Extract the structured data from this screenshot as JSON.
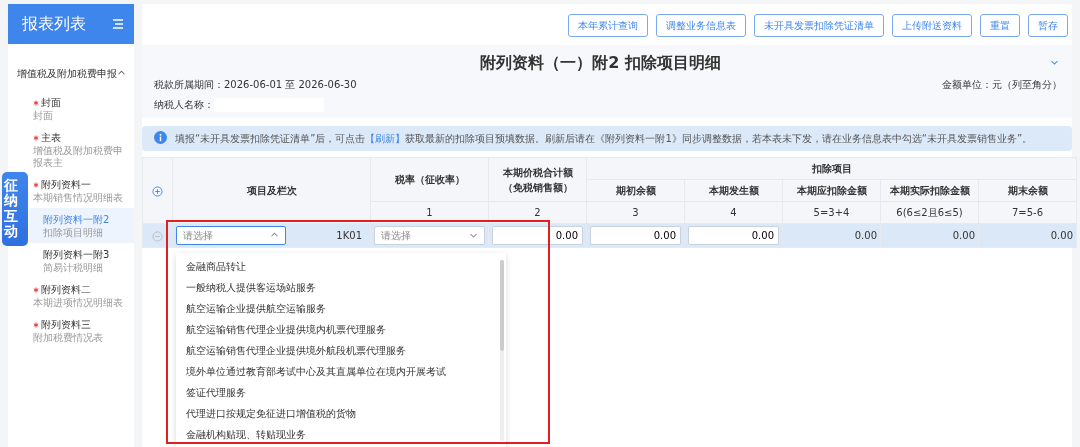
{
  "sidebar": {
    "title": "报表列表",
    "group": {
      "label": "增值税及附加税费申报",
      "expanded": true,
      "items": [
        {
          "title": "封面",
          "subtitle": "封面",
          "required": true,
          "selected": false
        },
        {
          "title": "主表",
          "subtitle": "增值税及附加税费申报表主",
          "required": true,
          "selected": false
        },
        {
          "title": "附列资料一",
          "subtitle": "本期销售情况明细表",
          "required": true,
          "selected": false,
          "children": [
            {
              "title": "附列资料一附2",
              "subtitle": "扣除项目明细",
              "required": false,
              "selected": true
            },
            {
              "title": "附列资料一附3",
              "subtitle": "简易计税明细",
              "required": false,
              "selected": false
            }
          ]
        },
        {
          "title": "附列资料二",
          "subtitle": "本期进项情况明细表",
          "required": true,
          "selected": false
        },
        {
          "title": "附列资料三",
          "subtitle": "附加税费情况表",
          "required": true,
          "selected": false
        }
      ]
    }
  },
  "float_tab": "征纳互动",
  "toolbar": {
    "buttons": [
      "本年累计查询",
      "调整业务信息表",
      "未开具发票扣除凭证清单",
      "上传附送资料",
      "重置",
      "暂存"
    ]
  },
  "header": {
    "title": "附列资料（一）附2 扣除项目明细",
    "period": "税款所属期间：2026-06-01 至 2026-06-30",
    "taxpayer_label": "纳税人名称：",
    "unit": "金额单位：元（列至角分）",
    "expanded": true
  },
  "notice": {
    "before": "填报“未开具发票扣除凭证清单”后，可点击",
    "link": "【刷新】",
    "after": "获取最新的扣除项目预填数据。刷新后请在《附列资料一附1》同步调整数据，若本表未下发，请在业务信息表中勾选“未开具发票销售业务”。"
  },
  "table": {
    "columns": [
      {
        "label": "项目及栏次"
      },
      {
        "label": "税率（征收率）",
        "number": "1"
      },
      {
        "label": "本期价税合计额（免税销售额）",
        "number": "2"
      }
    ],
    "group": {
      "label": "扣除项目",
      "columns": [
        {
          "label": "期初余额",
          "number": "3"
        },
        {
          "label": "本期发生额",
          "number": "4"
        },
        {
          "label": "本期应扣除金额",
          "number": "5=3+4"
        },
        {
          "label": "本期实际扣除金额",
          "number": "6(6≤2且6≤5)"
        },
        {
          "label": "期末余额",
          "number": "7=5-6"
        }
      ]
    },
    "rows": [
      {
        "selected": true,
        "cells": [
          {
            "kind": "select",
            "placeholder": "请选择",
            "expanded": true,
            "code": "1K01"
          },
          {
            "kind": "select",
            "placeholder": "请选择",
            "expanded": false
          },
          {
            "kind": "input",
            "value": "0.00"
          },
          {
            "kind": "input",
            "value": "0.00"
          },
          {
            "kind": "input",
            "value": "0.00"
          },
          {
            "kind": "text",
            "value": "0.00"
          },
          {
            "kind": "text",
            "value": "0.00"
          },
          {
            "kind": "text",
            "value": "0.00"
          }
        ]
      }
    ]
  },
  "dropdown": {
    "options": [
      "金融商品转让",
      "一般纳税人提供客运场站服务",
      "航空运输企业提供航空运输服务",
      "航空运输销售代理企业提供境内机票代理服务",
      "航空运输销售代理企业提供境外航段机票代理服务",
      "境外单位通过教育部考试中心及其直属单位在境内开展考试",
      "签证代理服务",
      "代理进口按规定免征进口增值税的货物",
      "金融机构贴现、转贴现业务"
    ]
  }
}
